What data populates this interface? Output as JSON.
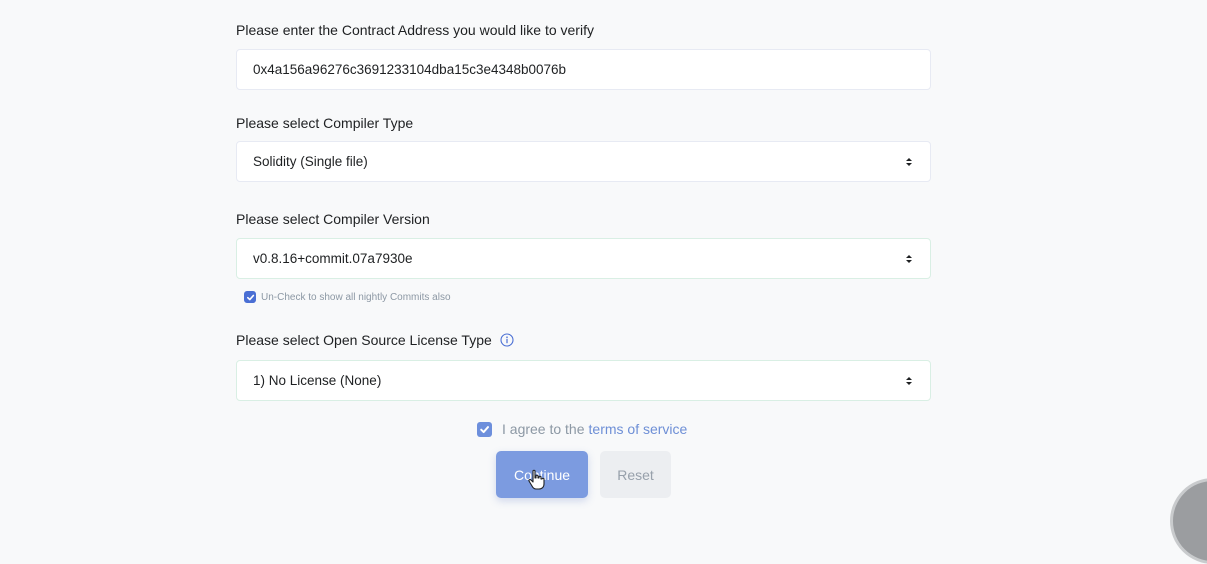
{
  "contract_address": {
    "label": "Please enter the Contract Address you would like to verify",
    "value": "0x4a156a96276c3691233104dba15c3e4348b0076b"
  },
  "compiler_type": {
    "label": "Please select Compiler Type",
    "selected": "Solidity (Single file)"
  },
  "compiler_version": {
    "label": "Please select Compiler Version",
    "selected": "v0.8.16+commit.07a7930e",
    "nightly_checkbox_label": "Un-Check to show all nightly Commits also",
    "nightly_checked": true
  },
  "license": {
    "label": "Please select Open Source License Type",
    "selected": "1) No License (None)",
    "info_icon": "info-circle-icon"
  },
  "agreement": {
    "prefix": "I agree to the",
    "link_text": "terms of service",
    "checked": true
  },
  "buttons": {
    "continue_label": "Continue",
    "reset_label": "Reset"
  },
  "colors": {
    "accent": "#4a6fd4",
    "continue_bg": "#7c9be0",
    "link": "#6e8fd6",
    "background": "#f8f9fa"
  }
}
